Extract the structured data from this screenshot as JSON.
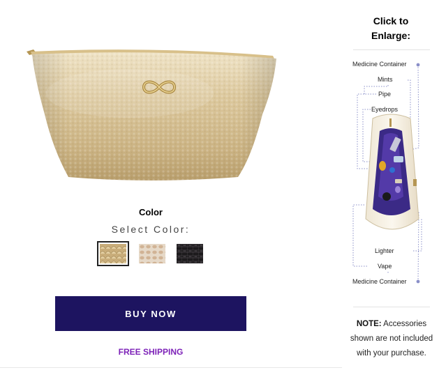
{
  "product": {
    "image_alt": "Gold pebbled leather pouch",
    "logo_icon": "infinity-knot-icon"
  },
  "color_section": {
    "heading": "Color",
    "select_label": "Select Color:",
    "swatches": [
      {
        "name": "gold",
        "color": "#c9ad7a",
        "selected": true
      },
      {
        "name": "snakeskin-beige",
        "color": "#d8c6b0",
        "selected": false
      },
      {
        "name": "black-croc",
        "color": "#1c1a1c",
        "selected": false
      }
    ]
  },
  "buy_button": {
    "label": "BUY NOW",
    "color": "#1d1460"
  },
  "free_shipping": {
    "label": "FREE SHIPPING",
    "color": "#7d22b8"
  },
  "sidebar": {
    "enlarge_line1": "Click to",
    "enlarge_line2": "Enlarge:",
    "callouts": {
      "medicine_top": "Medicine Container",
      "mints": "Mints",
      "pipe": "Pipe",
      "eyedrops": "Eyedrops",
      "lighter": "Lighter",
      "vape": "Vape",
      "medicine_bottom": "Medicine Container"
    },
    "note_label": "NOTE:",
    "note_text": " Accessories shown are not included with your purchase."
  }
}
